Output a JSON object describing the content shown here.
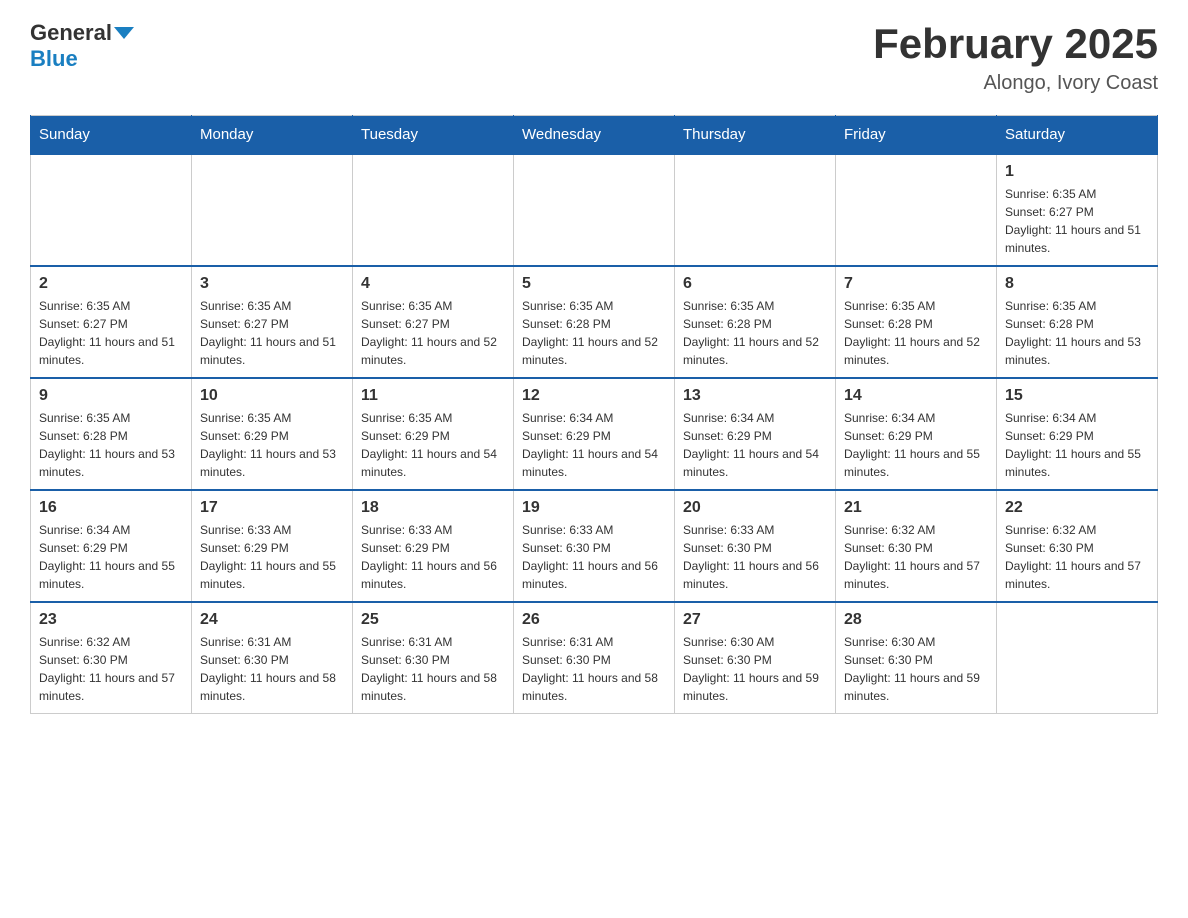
{
  "header": {
    "logo_general": "General",
    "logo_blue": "Blue",
    "month_title": "February 2025",
    "location": "Alongo, Ivory Coast"
  },
  "days_of_week": [
    "Sunday",
    "Monday",
    "Tuesday",
    "Wednesday",
    "Thursday",
    "Friday",
    "Saturday"
  ],
  "weeks": [
    [
      {
        "day": "",
        "sunrise": "",
        "sunset": "",
        "daylight": ""
      },
      {
        "day": "",
        "sunrise": "",
        "sunset": "",
        "daylight": ""
      },
      {
        "day": "",
        "sunrise": "",
        "sunset": "",
        "daylight": ""
      },
      {
        "day": "",
        "sunrise": "",
        "sunset": "",
        "daylight": ""
      },
      {
        "day": "",
        "sunrise": "",
        "sunset": "",
        "daylight": ""
      },
      {
        "day": "",
        "sunrise": "",
        "sunset": "",
        "daylight": ""
      },
      {
        "day": "1",
        "sunrise": "Sunrise: 6:35 AM",
        "sunset": "Sunset: 6:27 PM",
        "daylight": "Daylight: 11 hours and 51 minutes."
      }
    ],
    [
      {
        "day": "2",
        "sunrise": "Sunrise: 6:35 AM",
        "sunset": "Sunset: 6:27 PM",
        "daylight": "Daylight: 11 hours and 51 minutes."
      },
      {
        "day": "3",
        "sunrise": "Sunrise: 6:35 AM",
        "sunset": "Sunset: 6:27 PM",
        "daylight": "Daylight: 11 hours and 51 minutes."
      },
      {
        "day": "4",
        "sunrise": "Sunrise: 6:35 AM",
        "sunset": "Sunset: 6:27 PM",
        "daylight": "Daylight: 11 hours and 52 minutes."
      },
      {
        "day": "5",
        "sunrise": "Sunrise: 6:35 AM",
        "sunset": "Sunset: 6:28 PM",
        "daylight": "Daylight: 11 hours and 52 minutes."
      },
      {
        "day": "6",
        "sunrise": "Sunrise: 6:35 AM",
        "sunset": "Sunset: 6:28 PM",
        "daylight": "Daylight: 11 hours and 52 minutes."
      },
      {
        "day": "7",
        "sunrise": "Sunrise: 6:35 AM",
        "sunset": "Sunset: 6:28 PM",
        "daylight": "Daylight: 11 hours and 52 minutes."
      },
      {
        "day": "8",
        "sunrise": "Sunrise: 6:35 AM",
        "sunset": "Sunset: 6:28 PM",
        "daylight": "Daylight: 11 hours and 53 minutes."
      }
    ],
    [
      {
        "day": "9",
        "sunrise": "Sunrise: 6:35 AM",
        "sunset": "Sunset: 6:28 PM",
        "daylight": "Daylight: 11 hours and 53 minutes."
      },
      {
        "day": "10",
        "sunrise": "Sunrise: 6:35 AM",
        "sunset": "Sunset: 6:29 PM",
        "daylight": "Daylight: 11 hours and 53 minutes."
      },
      {
        "day": "11",
        "sunrise": "Sunrise: 6:35 AM",
        "sunset": "Sunset: 6:29 PM",
        "daylight": "Daylight: 11 hours and 54 minutes."
      },
      {
        "day": "12",
        "sunrise": "Sunrise: 6:34 AM",
        "sunset": "Sunset: 6:29 PM",
        "daylight": "Daylight: 11 hours and 54 minutes."
      },
      {
        "day": "13",
        "sunrise": "Sunrise: 6:34 AM",
        "sunset": "Sunset: 6:29 PM",
        "daylight": "Daylight: 11 hours and 54 minutes."
      },
      {
        "day": "14",
        "sunrise": "Sunrise: 6:34 AM",
        "sunset": "Sunset: 6:29 PM",
        "daylight": "Daylight: 11 hours and 55 minutes."
      },
      {
        "day": "15",
        "sunrise": "Sunrise: 6:34 AM",
        "sunset": "Sunset: 6:29 PM",
        "daylight": "Daylight: 11 hours and 55 minutes."
      }
    ],
    [
      {
        "day": "16",
        "sunrise": "Sunrise: 6:34 AM",
        "sunset": "Sunset: 6:29 PM",
        "daylight": "Daylight: 11 hours and 55 minutes."
      },
      {
        "day": "17",
        "sunrise": "Sunrise: 6:33 AM",
        "sunset": "Sunset: 6:29 PM",
        "daylight": "Daylight: 11 hours and 55 minutes."
      },
      {
        "day": "18",
        "sunrise": "Sunrise: 6:33 AM",
        "sunset": "Sunset: 6:29 PM",
        "daylight": "Daylight: 11 hours and 56 minutes."
      },
      {
        "day": "19",
        "sunrise": "Sunrise: 6:33 AM",
        "sunset": "Sunset: 6:30 PM",
        "daylight": "Daylight: 11 hours and 56 minutes."
      },
      {
        "day": "20",
        "sunrise": "Sunrise: 6:33 AM",
        "sunset": "Sunset: 6:30 PM",
        "daylight": "Daylight: 11 hours and 56 minutes."
      },
      {
        "day": "21",
        "sunrise": "Sunrise: 6:32 AM",
        "sunset": "Sunset: 6:30 PM",
        "daylight": "Daylight: 11 hours and 57 minutes."
      },
      {
        "day": "22",
        "sunrise": "Sunrise: 6:32 AM",
        "sunset": "Sunset: 6:30 PM",
        "daylight": "Daylight: 11 hours and 57 minutes."
      }
    ],
    [
      {
        "day": "23",
        "sunrise": "Sunrise: 6:32 AM",
        "sunset": "Sunset: 6:30 PM",
        "daylight": "Daylight: 11 hours and 57 minutes."
      },
      {
        "day": "24",
        "sunrise": "Sunrise: 6:31 AM",
        "sunset": "Sunset: 6:30 PM",
        "daylight": "Daylight: 11 hours and 58 minutes."
      },
      {
        "day": "25",
        "sunrise": "Sunrise: 6:31 AM",
        "sunset": "Sunset: 6:30 PM",
        "daylight": "Daylight: 11 hours and 58 minutes."
      },
      {
        "day": "26",
        "sunrise": "Sunrise: 6:31 AM",
        "sunset": "Sunset: 6:30 PM",
        "daylight": "Daylight: 11 hours and 58 minutes."
      },
      {
        "day": "27",
        "sunrise": "Sunrise: 6:30 AM",
        "sunset": "Sunset: 6:30 PM",
        "daylight": "Daylight: 11 hours and 59 minutes."
      },
      {
        "day": "28",
        "sunrise": "Sunrise: 6:30 AM",
        "sunset": "Sunset: 6:30 PM",
        "daylight": "Daylight: 11 hours and 59 minutes."
      },
      {
        "day": "",
        "sunrise": "",
        "sunset": "",
        "daylight": ""
      }
    ]
  ]
}
